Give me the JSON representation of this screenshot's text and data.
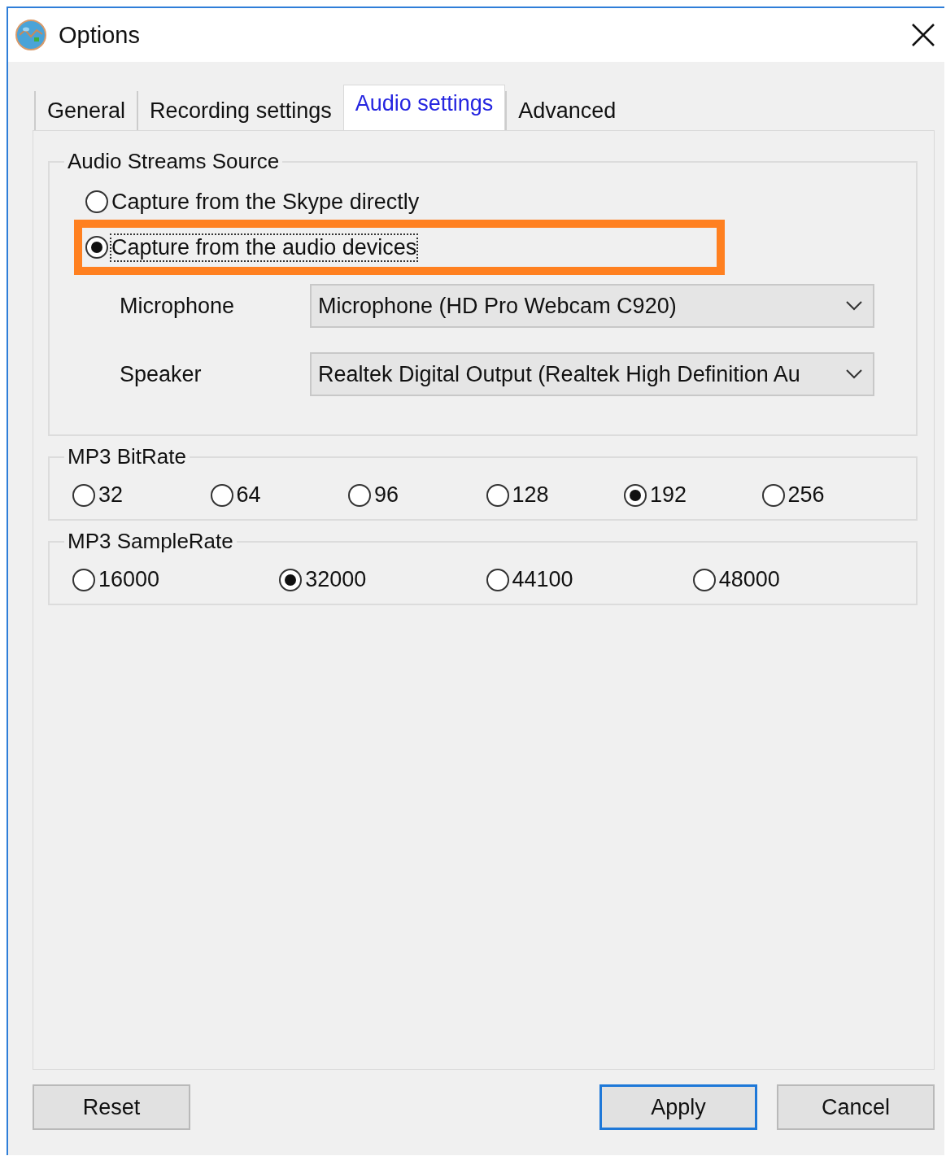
{
  "window": {
    "title": "Options"
  },
  "tabs": [
    {
      "label": "General",
      "selected": false
    },
    {
      "label": "Recording settings",
      "selected": false
    },
    {
      "label": "Audio settings",
      "selected": true
    },
    {
      "label": "Advanced",
      "selected": false
    }
  ],
  "audio_source": {
    "title": "Audio Streams Source",
    "options": [
      {
        "label": "Capture from the Skype directly",
        "selected": false,
        "focused": false,
        "highlighted": false
      },
      {
        "label": "Capture from the audio devices",
        "selected": true,
        "focused": true,
        "highlighted": true
      }
    ],
    "devices": [
      {
        "label": "Microphone",
        "value": "Microphone (HD Pro Webcam C920)"
      },
      {
        "label": "Speaker",
        "value": "Realtek Digital Output (Realtek High Definition Au"
      }
    ]
  },
  "bitrate": {
    "title": "MP3 BitRate",
    "options": [
      {
        "label": "32",
        "selected": false
      },
      {
        "label": "64",
        "selected": false
      },
      {
        "label": "96",
        "selected": false
      },
      {
        "label": "128",
        "selected": false
      },
      {
        "label": "192",
        "selected": true
      },
      {
        "label": "256",
        "selected": false
      }
    ]
  },
  "samplerate": {
    "title": "MP3 SampleRate",
    "options": [
      {
        "label": "16000",
        "selected": false
      },
      {
        "label": "32000",
        "selected": true
      },
      {
        "label": "44100",
        "selected": false
      },
      {
        "label": "48000",
        "selected": false
      }
    ]
  },
  "buttons": [
    {
      "label": "Reset",
      "kind": "normal"
    },
    {
      "label": "Apply",
      "kind": "default"
    },
    {
      "label": "Cancel",
      "kind": "normal"
    }
  ]
}
